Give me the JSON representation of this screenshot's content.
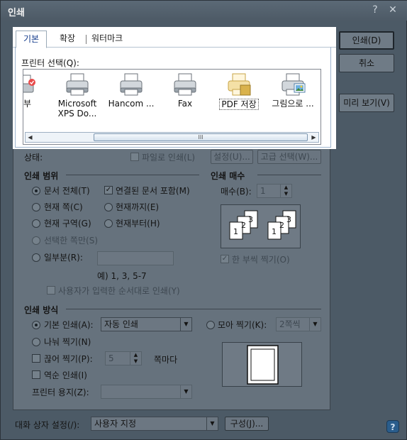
{
  "window": {
    "title": "인쇄",
    "help_glyph": "?",
    "close_glyph": "✕"
  },
  "tabs": [
    {
      "label": "기본"
    },
    {
      "label": "확장"
    },
    {
      "label": "워터마크"
    }
  ],
  "printer_section": {
    "label": "프린터 선택(Q):",
    "printers": [
      {
        "name": "집부",
        "icon": "printer-partial-icon"
      },
      {
        "name": "Microsoft\nXPS Do...",
        "icon": "printer-icon"
      },
      {
        "name": "Hancom ...",
        "icon": "printer-icon"
      },
      {
        "name": "Fax",
        "icon": "fax-printer-icon"
      },
      {
        "name": "PDF 저장",
        "icon": "pdf-printer-icon",
        "selected": true
      },
      {
        "name": "그림으로 ...",
        "icon": "image-printer-icon"
      }
    ],
    "scroll_thumb_glyph": "III"
  },
  "right_buttons": {
    "print": "인쇄(D)",
    "cancel": "취소",
    "preview": "미리 보기(V)"
  },
  "status": {
    "label": "상태:",
    "print_to_file": "파일로 인쇄(L)",
    "settings": "설정(U)...",
    "advanced": "고급 선택(W)..."
  },
  "print_range": {
    "title": "인쇄 범위",
    "whole_doc": "문서 전체(T)",
    "linked_docs": "연결된 문서 포함(M)",
    "current_page": "현재 쪽(C)",
    "until_current": "현재까지(E)",
    "current_section": "현재 구역(G)",
    "from_current": "현재부터(H)",
    "selected_pages": "선택한 쪽만(S)",
    "partial": "일부분(R):",
    "example": "예) 1, 3, 5-7",
    "user_order": "사용자가 입력한 순서대로 인쇄(Y)"
  },
  "copies": {
    "title": "인쇄 매수",
    "count_label": "매수(B):",
    "count_value": "1",
    "collate": "한 부씩 찍기(O)",
    "page_digits": [
      "1",
      "2",
      "3",
      "1",
      "2",
      "3"
    ]
  },
  "print_method": {
    "title": "인쇄 방식",
    "basic": "기본 인쇄(A):",
    "basic_value": "자동 인쇄",
    "gather": "모아 찍기(K):",
    "gather_value": "2쪽씩",
    "split": "나눠 찍기(N)",
    "cut": "끊어 찍기(P):",
    "cut_value": "5",
    "per_page": "쪽마다",
    "reverse": "역순 인쇄(I)",
    "paper": "프린터 용지(Z):"
  },
  "footer": {
    "dialog_settings": "대화 상자 설정(/):",
    "dialog_value": "사용자 지정",
    "configure": "구성(J)...",
    "help_glyph": "?"
  },
  "colors": {
    "dim_background": "#4c5a66",
    "highlight_background": "#ffffff",
    "selection_border": "#9fb6d0"
  }
}
